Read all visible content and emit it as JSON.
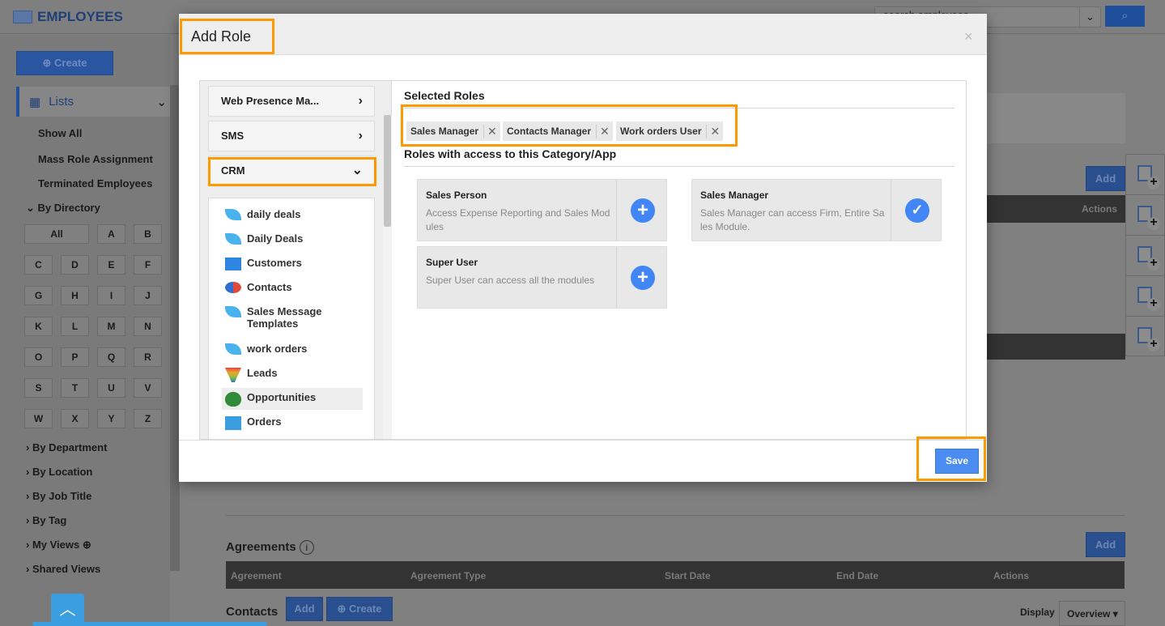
{
  "app": {
    "title": "EMPLOYEES",
    "search_placeholder": "search employees"
  },
  "sidebar": {
    "create_label": "Create",
    "lists_label": "Lists",
    "links": [
      "Show All",
      "Mass Role Assignment",
      "Terminated Employees"
    ],
    "by_directory": "By Directory",
    "letters": [
      "All",
      "A",
      "B",
      "C",
      "D",
      "E",
      "F",
      "G",
      "H",
      "I",
      "J",
      "K",
      "L",
      "M",
      "N",
      "O",
      "P",
      "Q",
      "R",
      "S",
      "T",
      "U",
      "V",
      "W",
      "X",
      "Y",
      "Z"
    ],
    "sections": [
      "By Department",
      "By Location",
      "By Job Title",
      "By Tag",
      "My Views",
      "Shared Views"
    ]
  },
  "main": {
    "add_label": "Add",
    "actions_header": "Actions",
    "agreements": {
      "title": "Agreements",
      "add_label": "Add",
      "columns": [
        "Agreement",
        "Agreement Type",
        "Start Date",
        "End Date",
        "Actions"
      ]
    },
    "contacts": {
      "title": "Contacts",
      "add_label": "Add",
      "create_label": "Create",
      "display_label": "Display",
      "display_value": "Overview"
    }
  },
  "modal": {
    "title": "Add Role",
    "close": "×",
    "categories": [
      {
        "label": "Web Presence Ma...",
        "state": "collapsed"
      },
      {
        "label": "SMS",
        "state": "collapsed"
      },
      {
        "label": "CRM",
        "state": "expanded"
      }
    ],
    "apps": [
      {
        "label": "daily deals",
        "icon": "leaf-icon"
      },
      {
        "label": "Daily Deals",
        "icon": "leaf-icon"
      },
      {
        "label": "Customers",
        "icon": "building-icon"
      },
      {
        "label": "Contacts",
        "icon": "contacts-icon"
      },
      {
        "label": "Sales Message Templates",
        "icon": "leaf-icon"
      },
      {
        "label": "work orders",
        "icon": "leaf-icon"
      },
      {
        "label": "Leads",
        "icon": "funnel-icon"
      },
      {
        "label": "Opportunities",
        "icon": "money-bag-icon",
        "selected": true
      },
      {
        "label": "Orders",
        "icon": "shopping-bag-icon"
      }
    ],
    "selected_roles_heading": "Selected Roles",
    "selected_roles": [
      "Sales Manager",
      "Contacts Manager",
      "Work orders User"
    ],
    "roles_heading": "Roles with access to this Category/App",
    "roles": [
      {
        "name": "Sales Person",
        "desc": "Access Expense Reporting and Sales Modules",
        "added": false
      },
      {
        "name": "Sales Manager",
        "desc": "Sales Manager can access Firm, Entire Sales Module.",
        "added": true
      },
      {
        "name": "Super User",
        "desc": "Super User can access all the modules",
        "added": false
      }
    ],
    "save_label": "Save"
  },
  "colors": {
    "highlight": "#ff9900",
    "primary": "#4a8cf0"
  }
}
